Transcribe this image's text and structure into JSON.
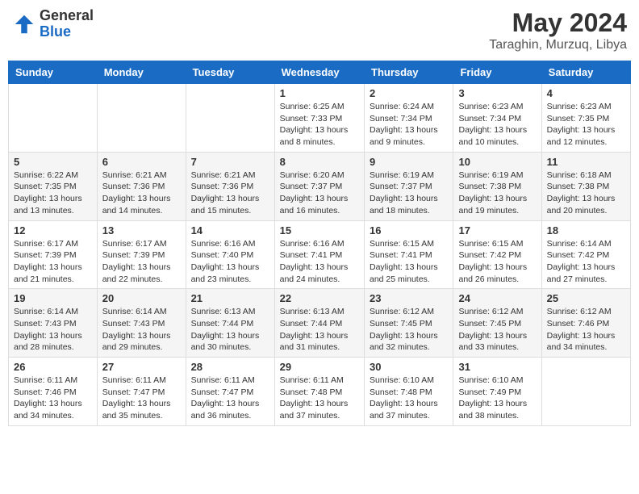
{
  "logo": {
    "general": "General",
    "blue": "Blue"
  },
  "title": "May 2024",
  "subtitle": "Taraghin, Murzuq, Libya",
  "days_of_week": [
    "Sunday",
    "Monday",
    "Tuesday",
    "Wednesday",
    "Thursday",
    "Friday",
    "Saturday"
  ],
  "weeks": [
    [
      {
        "day": "",
        "info": ""
      },
      {
        "day": "",
        "info": ""
      },
      {
        "day": "",
        "info": ""
      },
      {
        "day": "1",
        "info": "Sunrise: 6:25 AM\nSunset: 7:33 PM\nDaylight: 13 hours and 8 minutes."
      },
      {
        "day": "2",
        "info": "Sunrise: 6:24 AM\nSunset: 7:34 PM\nDaylight: 13 hours and 9 minutes."
      },
      {
        "day": "3",
        "info": "Sunrise: 6:23 AM\nSunset: 7:34 PM\nDaylight: 13 hours and 10 minutes."
      },
      {
        "day": "4",
        "info": "Sunrise: 6:23 AM\nSunset: 7:35 PM\nDaylight: 13 hours and 12 minutes."
      }
    ],
    [
      {
        "day": "5",
        "info": "Sunrise: 6:22 AM\nSunset: 7:35 PM\nDaylight: 13 hours and 13 minutes."
      },
      {
        "day": "6",
        "info": "Sunrise: 6:21 AM\nSunset: 7:36 PM\nDaylight: 13 hours and 14 minutes."
      },
      {
        "day": "7",
        "info": "Sunrise: 6:21 AM\nSunset: 7:36 PM\nDaylight: 13 hours and 15 minutes."
      },
      {
        "day": "8",
        "info": "Sunrise: 6:20 AM\nSunset: 7:37 PM\nDaylight: 13 hours and 16 minutes."
      },
      {
        "day": "9",
        "info": "Sunrise: 6:19 AM\nSunset: 7:37 PM\nDaylight: 13 hours and 18 minutes."
      },
      {
        "day": "10",
        "info": "Sunrise: 6:19 AM\nSunset: 7:38 PM\nDaylight: 13 hours and 19 minutes."
      },
      {
        "day": "11",
        "info": "Sunrise: 6:18 AM\nSunset: 7:38 PM\nDaylight: 13 hours and 20 minutes."
      }
    ],
    [
      {
        "day": "12",
        "info": "Sunrise: 6:17 AM\nSunset: 7:39 PM\nDaylight: 13 hours and 21 minutes."
      },
      {
        "day": "13",
        "info": "Sunrise: 6:17 AM\nSunset: 7:39 PM\nDaylight: 13 hours and 22 minutes."
      },
      {
        "day": "14",
        "info": "Sunrise: 6:16 AM\nSunset: 7:40 PM\nDaylight: 13 hours and 23 minutes."
      },
      {
        "day": "15",
        "info": "Sunrise: 6:16 AM\nSunset: 7:41 PM\nDaylight: 13 hours and 24 minutes."
      },
      {
        "day": "16",
        "info": "Sunrise: 6:15 AM\nSunset: 7:41 PM\nDaylight: 13 hours and 25 minutes."
      },
      {
        "day": "17",
        "info": "Sunrise: 6:15 AM\nSunset: 7:42 PM\nDaylight: 13 hours and 26 minutes."
      },
      {
        "day": "18",
        "info": "Sunrise: 6:14 AM\nSunset: 7:42 PM\nDaylight: 13 hours and 27 minutes."
      }
    ],
    [
      {
        "day": "19",
        "info": "Sunrise: 6:14 AM\nSunset: 7:43 PM\nDaylight: 13 hours and 28 minutes."
      },
      {
        "day": "20",
        "info": "Sunrise: 6:14 AM\nSunset: 7:43 PM\nDaylight: 13 hours and 29 minutes."
      },
      {
        "day": "21",
        "info": "Sunrise: 6:13 AM\nSunset: 7:44 PM\nDaylight: 13 hours and 30 minutes."
      },
      {
        "day": "22",
        "info": "Sunrise: 6:13 AM\nSunset: 7:44 PM\nDaylight: 13 hours and 31 minutes."
      },
      {
        "day": "23",
        "info": "Sunrise: 6:12 AM\nSunset: 7:45 PM\nDaylight: 13 hours and 32 minutes."
      },
      {
        "day": "24",
        "info": "Sunrise: 6:12 AM\nSunset: 7:45 PM\nDaylight: 13 hours and 33 minutes."
      },
      {
        "day": "25",
        "info": "Sunrise: 6:12 AM\nSunset: 7:46 PM\nDaylight: 13 hours and 34 minutes."
      }
    ],
    [
      {
        "day": "26",
        "info": "Sunrise: 6:11 AM\nSunset: 7:46 PM\nDaylight: 13 hours and 34 minutes."
      },
      {
        "day": "27",
        "info": "Sunrise: 6:11 AM\nSunset: 7:47 PM\nDaylight: 13 hours and 35 minutes."
      },
      {
        "day": "28",
        "info": "Sunrise: 6:11 AM\nSunset: 7:47 PM\nDaylight: 13 hours and 36 minutes."
      },
      {
        "day": "29",
        "info": "Sunrise: 6:11 AM\nSunset: 7:48 PM\nDaylight: 13 hours and 37 minutes."
      },
      {
        "day": "30",
        "info": "Sunrise: 6:10 AM\nSunset: 7:48 PM\nDaylight: 13 hours and 37 minutes."
      },
      {
        "day": "31",
        "info": "Sunrise: 6:10 AM\nSunset: 7:49 PM\nDaylight: 13 hours and 38 minutes."
      },
      {
        "day": "",
        "info": ""
      }
    ]
  ]
}
